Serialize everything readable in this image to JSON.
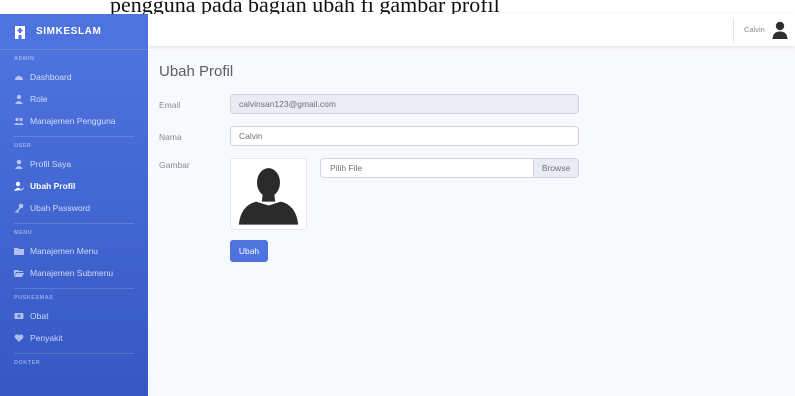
{
  "caption": "pengguna pada bagian ubah fi gambar profil",
  "brand": {
    "name": "SIMKESLAM",
    "icon": "hospital-icon"
  },
  "sidebar": {
    "sections": [
      {
        "heading": "ADMIN",
        "items": [
          {
            "label": "Dashboard",
            "icon": "tachometer-icon"
          },
          {
            "label": "Role",
            "icon": "user-tie-icon"
          },
          {
            "label": "Manajemen Pengguna",
            "icon": "users-icon"
          }
        ]
      },
      {
        "heading": "USER",
        "items": [
          {
            "label": "Profil Saya",
            "icon": "user-icon"
          },
          {
            "label": "Ubah Profil",
            "icon": "user-edit-icon",
            "active": true
          },
          {
            "label": "Ubah Password",
            "icon": "key-icon"
          }
        ]
      },
      {
        "heading": "MENU",
        "items": [
          {
            "label": "Manajemen Menu",
            "icon": "folder-icon"
          },
          {
            "label": "Manajemen Submenu",
            "icon": "folder-open-icon"
          }
        ]
      },
      {
        "heading": "PUSKESMAS",
        "items": [
          {
            "label": "Obat",
            "icon": "capsules-icon"
          },
          {
            "label": "Penyakit",
            "icon": "heart-icon"
          }
        ]
      },
      {
        "heading": "DOKTER",
        "items": []
      }
    ]
  },
  "topbar": {
    "user_name": "Calvin",
    "user_icon": "user-icon"
  },
  "main": {
    "title": "Ubah Profil",
    "email_label": "Email",
    "email_value": "calvinsan123@gmail.com",
    "name_label": "Nama",
    "name_value": "Calvin",
    "image_label": "Gambar",
    "file_placeholder": "Pilih File",
    "browse_label": "Browse",
    "submit_label": "Ubah"
  },
  "colors": {
    "primary": "#4e73df",
    "background": "#f8f9fc",
    "text": "#858796"
  }
}
